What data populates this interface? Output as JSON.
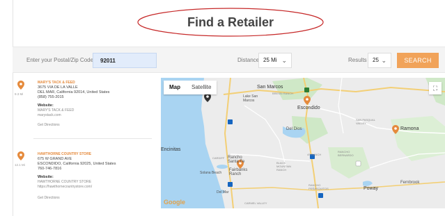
{
  "page": {
    "title": "Find a Retailer"
  },
  "search": {
    "zip_label": "Enter your Postal/Zip Code:",
    "zip_value": "92011",
    "distance_label": "Distance",
    "distance_value": "25 Mi",
    "results_label": "Results",
    "results_value": "25",
    "search_button": "SEARCH",
    "accent": "#f1a35a"
  },
  "retailers": [
    {
      "distance": "9.3 Mi",
      "name": "MARY'S TACK & FEED",
      "address1": "3675 VIA DE LA VALLE",
      "address2": "DEL MAR, California 92014, United States",
      "phone": "(858) 755-2015",
      "website_label": "Website:",
      "website_name": "MARY'S TACK & FEED",
      "website_url": "marystack.com",
      "directions": "Get Directions"
    },
    {
      "distance": "12.1 Mi",
      "name": "HAWTHORNE COUNTRY STORE",
      "address1": "675 W GRAND AVE",
      "address2": "ESCONDIDO, California 92025, United States",
      "phone": "760-746-7816",
      "website_label": "Website:",
      "website_name": "HAWTHORNE COUNTRY STORE",
      "website_url": "https://hawthornecountrystore.com/",
      "directions": "Get Directions"
    }
  ],
  "map": {
    "tab_map": "Map",
    "tab_satellite": "Satellite",
    "fullscreen_icon": "fullscreen-icon",
    "attribution": "Google",
    "labels": {
      "san_marcos": "San Marcos",
      "lake_san_marcos": "Lake San\nMarcos",
      "escondido": "Escondido",
      "del_dios": "Del Dios",
      "san_pasqual_valley": "SAN PASQUAL\nVALLEY",
      "encinitas": "Encinitas",
      "rancho_santa_fe": "Rancho\nSanta Fe",
      "fairbanks_ranch": "Fairbanks\nRanch",
      "solana_beach": "Solana Beach",
      "del_mar": "Del Mar",
      "black_mountain_ranch": "BLACK\nMOUNTAIN\nRANCH",
      "rancho_bernardo": "RANCHO\nBERNARDO",
      "poway": "Poway",
      "ramona": "Ramona",
      "fernbrook": "Fernbrook",
      "carmel_valley": "CARMEL VALLEY",
      "cardiff": "CARDIFF",
      "bressi_ranch": "BRESSI RANCH",
      "rancho_penasquitos": "RANCHO\nPEÑASQUITOS",
      "4s_ranch": "4S RANCH"
    },
    "colors": {
      "land": "#ececec",
      "water": "#a9d4f2",
      "park": "#cfe8c7",
      "marker": "#e58a3c"
    }
  }
}
